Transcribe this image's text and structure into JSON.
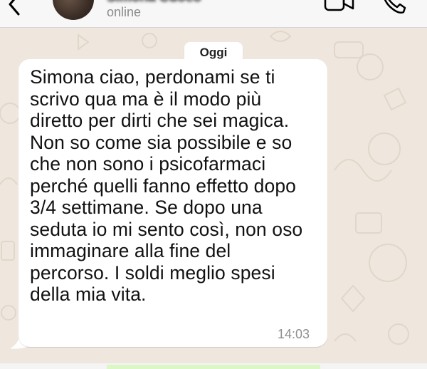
{
  "header": {
    "contact_name": "Simona Cuoco",
    "status": "online",
    "icons": [
      "chevron-left-icon",
      "video-camera-icon",
      "phone-icon"
    ]
  },
  "chat": {
    "date_label": "Oggi",
    "message": {
      "lines": [
        "Simona ciao, perdonami se ti",
        "scrivo qua ma è il modo più",
        "diretto per dirti che sei magica.",
        "Non so come sia possibile e so",
        "che non sono i psicofarmaci",
        "perché quelli fanno effetto dopo",
        "3/4 settimane. Se dopo una",
        "seduta io mi sento così, non oso",
        "immaginare alla fine del",
        "percorso. I soldi meglio spesi",
        "della mia vita."
      ],
      "time": "14:03"
    }
  },
  "colors": {
    "wallpaper": "#efe7dd",
    "bubble": "#ffffff",
    "header_bg": "#f7f7f7",
    "accent_icons": "#000000"
  }
}
